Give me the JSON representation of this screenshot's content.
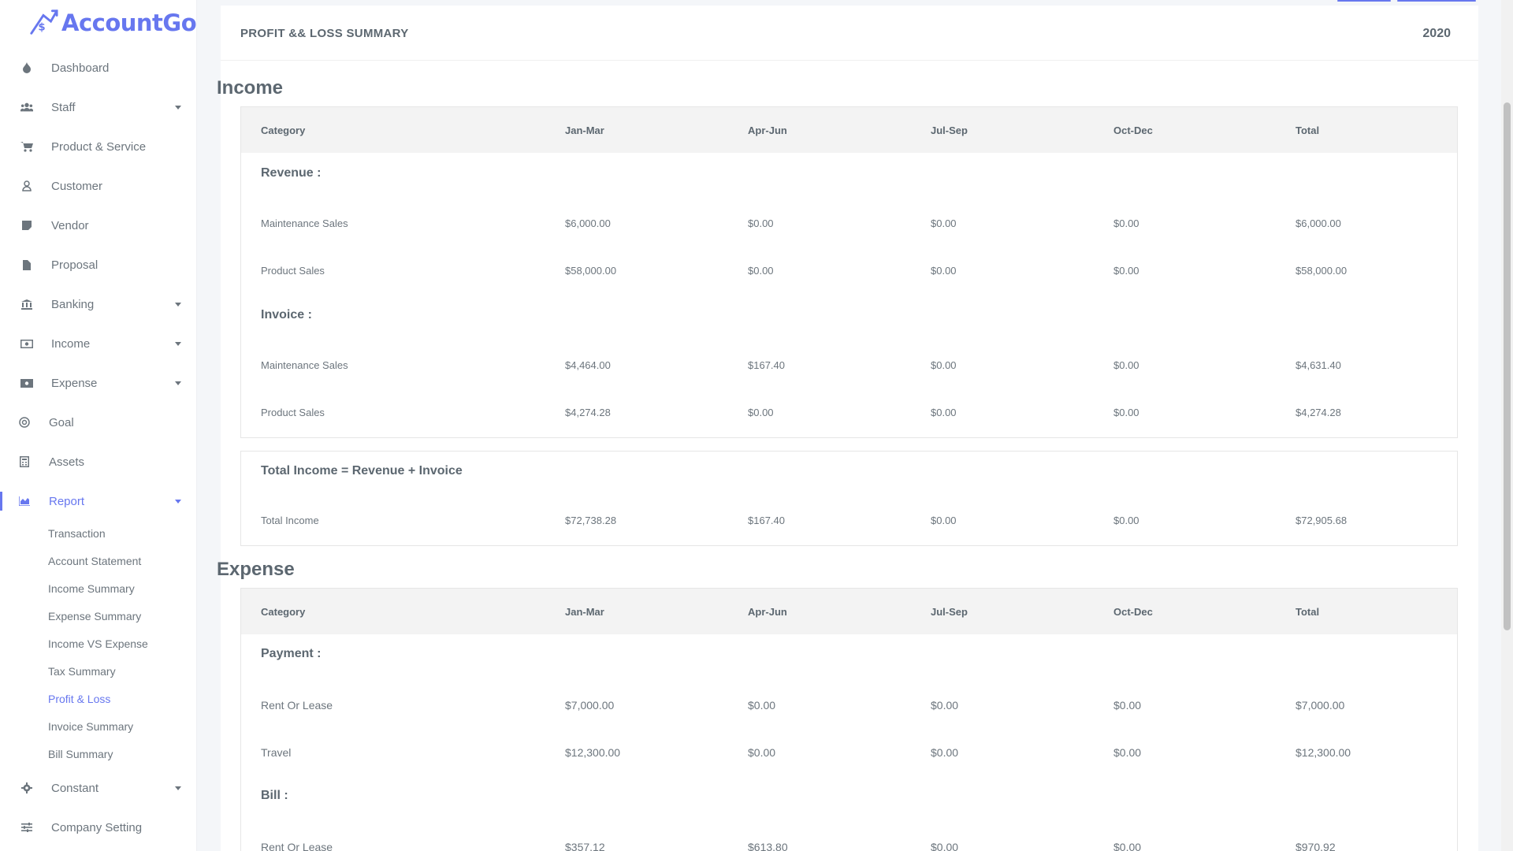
{
  "app": {
    "logo_text": "AccountGo",
    "accent": "#6777ef"
  },
  "sidebar": {
    "items": [
      {
        "label": "Dashboard",
        "icon": "fire-icon",
        "has_caret": false
      },
      {
        "label": "Staff",
        "icon": "users-icon",
        "has_caret": true
      },
      {
        "label": "Product & Service",
        "icon": "cart-icon",
        "has_caret": false
      },
      {
        "label": "Customer",
        "icon": "user-icon",
        "has_caret": false
      },
      {
        "label": "Vendor",
        "icon": "note-icon",
        "has_caret": false
      },
      {
        "label": "Proposal",
        "icon": "file-icon",
        "has_caret": false
      },
      {
        "label": "Banking",
        "icon": "bank-icon",
        "has_caret": true
      },
      {
        "label": "Income",
        "icon": "money-icon",
        "has_caret": true
      },
      {
        "label": "Expense",
        "icon": "money-bill-icon",
        "has_caret": true
      },
      {
        "label": "Goal",
        "icon": "target-icon",
        "has_caret": false
      },
      {
        "label": "Assets",
        "icon": "calculator-icon",
        "has_caret": false
      },
      {
        "label": "Report",
        "icon": "chart-area-icon",
        "has_caret": true,
        "active": true
      },
      {
        "label": "Constant",
        "icon": "cog-icon",
        "has_caret": true
      },
      {
        "label": "Company Setting",
        "icon": "sliders-icon",
        "has_caret": false
      }
    ],
    "report_sub_items": [
      "Transaction",
      "Account Statement",
      "Income Summary",
      "Expense Summary",
      "Income VS Expense",
      "Tax Summary",
      "Profit & Loss",
      "Invoice Summary",
      "Bill Summary"
    ],
    "active_sub_item": "Profit & Loss"
  },
  "page": {
    "title": "PROFIT && LOSS SUMMARY",
    "year": "2020"
  },
  "income": {
    "section_title": "Income",
    "columns": [
      "Category",
      "Jan-Mar",
      "Apr-Jun",
      "Jul-Sep",
      "Oct-Dec",
      "Total"
    ],
    "revenue_label": "Revenue :",
    "revenue_rows": [
      [
        "Maintenance Sales",
        "$6,000.00",
        "$0.00",
        "$0.00",
        "$0.00",
        "$6,000.00"
      ],
      [
        "Product Sales",
        "$58,000.00",
        "$0.00",
        "$0.00",
        "$0.00",
        "$58,000.00"
      ]
    ],
    "invoice_label": "Invoice :",
    "invoice_rows": [
      [
        "Maintenance Sales",
        "$4,464.00",
        "$167.40",
        "$0.00",
        "$0.00",
        "$4,631.40"
      ],
      [
        "Product Sales",
        "$4,274.28",
        "$0.00",
        "$0.00",
        "$0.00",
        "$4,274.28"
      ]
    ],
    "total_title": "Total Income = Revenue + Invoice",
    "total_row": [
      "Total Income",
      "$72,738.28",
      "$167.40",
      "$0.00",
      "$0.00",
      "$72,905.68"
    ]
  },
  "expense": {
    "section_title": "Expense",
    "columns": [
      "Category",
      "Jan-Mar",
      "Apr-Jun",
      "Jul-Sep",
      "Oct-Dec",
      "Total"
    ],
    "payment_label": "Payment :",
    "payment_rows": [
      [
        "Rent Or Lease",
        "$7,000.00",
        "$0.00",
        "$0.00",
        "$0.00",
        "$7,000.00"
      ],
      [
        "Travel",
        "$12,300.00",
        "$0.00",
        "$0.00",
        "$0.00",
        "$12,300.00"
      ]
    ],
    "bill_label": "Bill :",
    "bill_rows": [
      [
        "Rent Or Lease",
        "$357.12",
        "$613.80",
        "$0.00",
        "$0.00",
        "$970.92"
      ]
    ]
  }
}
